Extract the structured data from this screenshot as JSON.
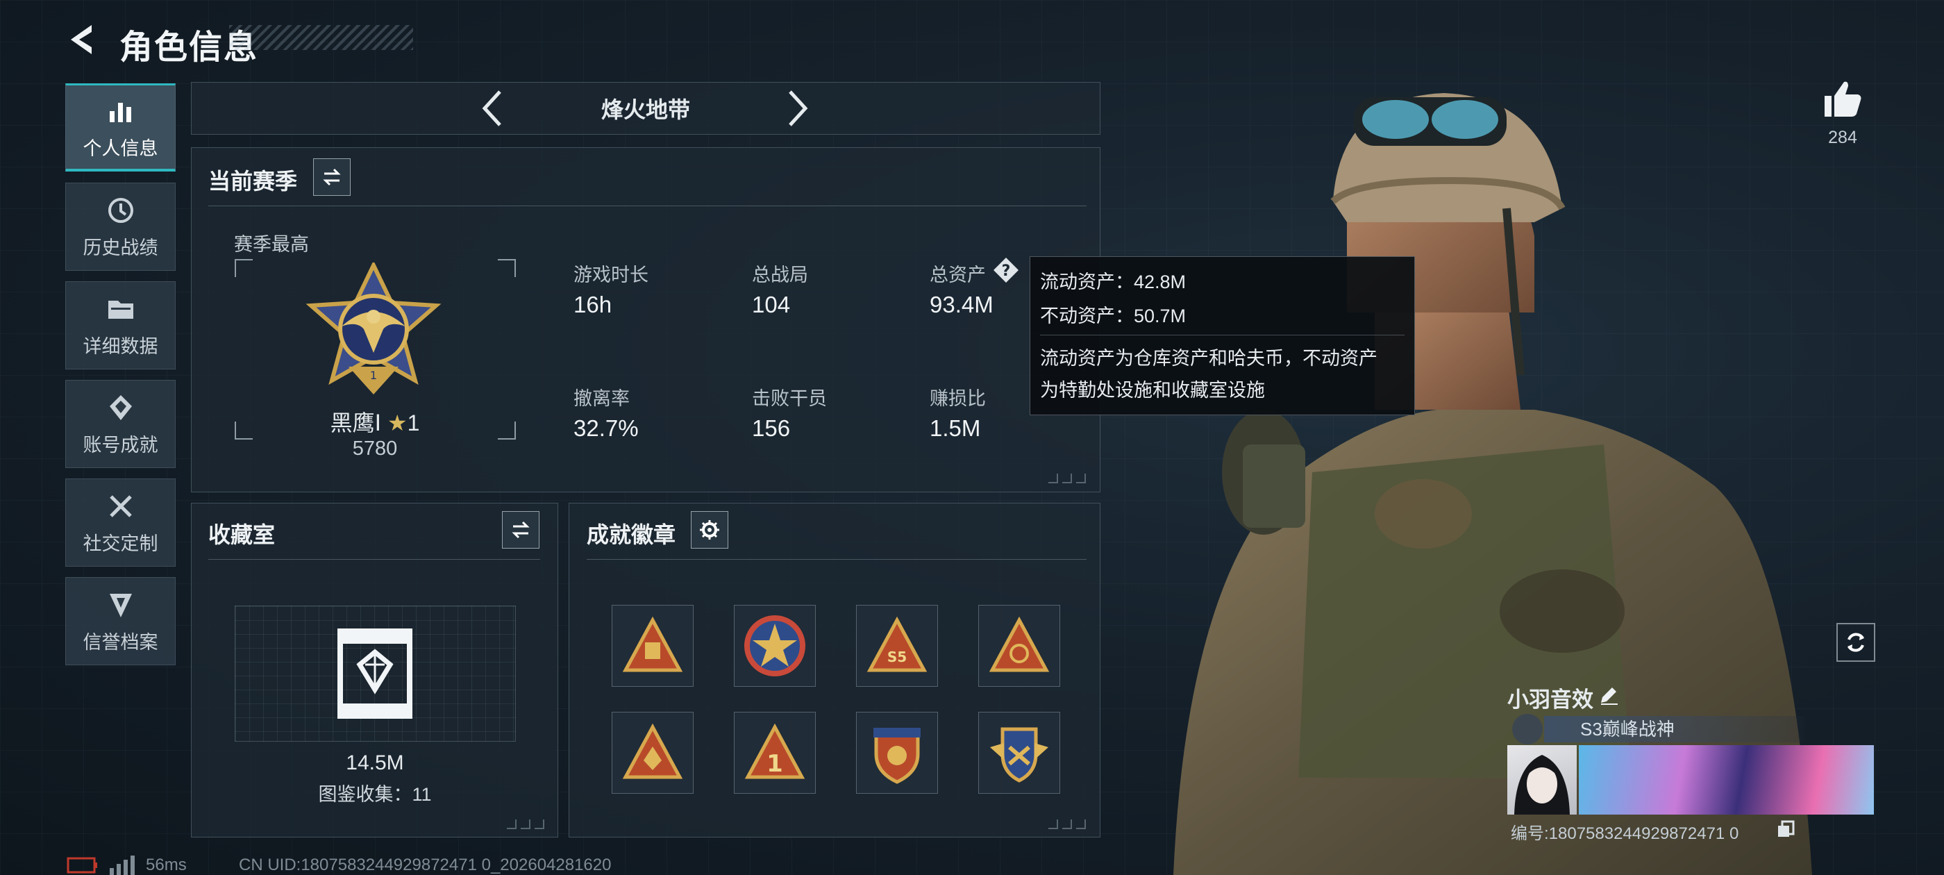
{
  "header": {
    "title": "角色信息"
  },
  "sidebar": {
    "items": [
      {
        "label": "个人信息",
        "icon": "bar-chart-icon",
        "active": true
      },
      {
        "label": "历史战绩",
        "icon": "history-clock-icon"
      },
      {
        "label": "详细数据",
        "icon": "folder-icon"
      },
      {
        "label": "账号成就",
        "icon": "achievement-diamond-icon"
      },
      {
        "label": "社交定制",
        "icon": "tools-wrench-icon"
      },
      {
        "label": "信誉档案",
        "icon": "shield-badge-icon"
      }
    ]
  },
  "mode_selector": {
    "label": "烽火地带"
  },
  "season": {
    "title": "当前赛季",
    "best_label": "赛季最高",
    "rank_name": "黑鹰Ⅰ",
    "rank_stars": "1",
    "rank_points": "5780",
    "stats": [
      {
        "label": "游戏时长",
        "value": "16h"
      },
      {
        "label": "总战局",
        "value": "104"
      },
      {
        "label": "总资产",
        "value": "93.4M"
      },
      {
        "label": "撤离率",
        "value": "32.7%"
      },
      {
        "label": "击败干员",
        "value": "156"
      },
      {
        "label": "赚损比",
        "value": "1.5M"
      }
    ]
  },
  "tooltip": {
    "liquid": "流动资产：42.8M",
    "fixed": "不动资产：50.7M",
    "desc_line1": "流动资产为仓库资产和哈夫币，不动资产",
    "desc_line2": "为特勤处设施和收藏室设施"
  },
  "collection": {
    "title": "收藏室",
    "value": "14.5M",
    "count_text": "图鉴收集：11"
  },
  "achievements": {
    "title": "成就徽章",
    "badges": [
      "triangle-gift-badge-icon",
      "star-medal-badge-icon",
      "crown-s5-badge-icon",
      "triangle-emblem-badge-icon",
      "triangle-crest-badge-icon",
      "triangle-one-badge-icon",
      "shield-crest-badge-icon",
      "winged-shield-badge-icon"
    ]
  },
  "likes": {
    "count": "284"
  },
  "player": {
    "name": "小羽音效",
    "title": "S3巅峰战神",
    "id_text": "编号:1807583244929872471 0"
  },
  "status": {
    "ping": "56ms",
    "uid": "CN UID:1807583244929872471 0_202604281620"
  },
  "colors": {
    "accent": "#2fb8c0",
    "gold": "#c9a24a",
    "panel": "#1c2832"
  }
}
